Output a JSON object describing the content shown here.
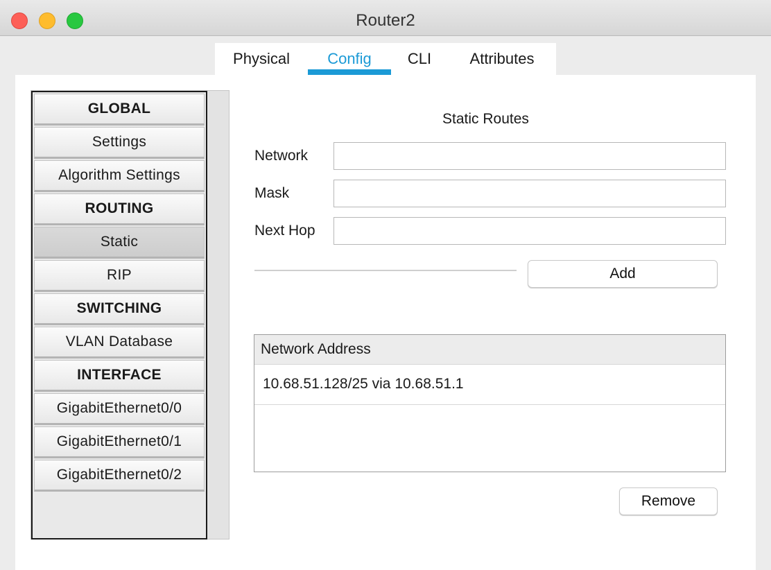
{
  "window": {
    "title": "Router2"
  },
  "tabs": [
    {
      "label": "Physical"
    },
    {
      "label": "Config",
      "active": true
    },
    {
      "label": "CLI"
    },
    {
      "label": "Attributes"
    }
  ],
  "sidebar": {
    "items": [
      {
        "label": "GLOBAL",
        "type": "header"
      },
      {
        "label": "Settings",
        "type": "item"
      },
      {
        "label": "Algorithm Settings",
        "type": "item"
      },
      {
        "label": "ROUTING",
        "type": "header"
      },
      {
        "label": "Static",
        "type": "item",
        "selected": true
      },
      {
        "label": "RIP",
        "type": "item"
      },
      {
        "label": "SWITCHING",
        "type": "header"
      },
      {
        "label": "VLAN Database",
        "type": "item"
      },
      {
        "label": "INTERFACE",
        "type": "header"
      },
      {
        "label": "GigabitEthernet0/0",
        "type": "item"
      },
      {
        "label": "GigabitEthernet0/1",
        "type": "item"
      },
      {
        "label": "GigabitEthernet0/2",
        "type": "item"
      }
    ]
  },
  "static_routes": {
    "title": "Static Routes",
    "fields": {
      "network": {
        "label": "Network",
        "value": ""
      },
      "mask": {
        "label": "Mask",
        "value": ""
      },
      "next_hop": {
        "label": "Next Hop",
        "value": ""
      }
    },
    "add_label": "Add",
    "table": {
      "header": "Network Address",
      "rows": [
        "10.68.51.128/25 via 10.68.51.1"
      ]
    },
    "remove_label": "Remove"
  },
  "colors": {
    "accent": "#1b9ad6",
    "close": "#fd5f57",
    "minimize": "#febc2e",
    "zoom": "#28c840"
  }
}
